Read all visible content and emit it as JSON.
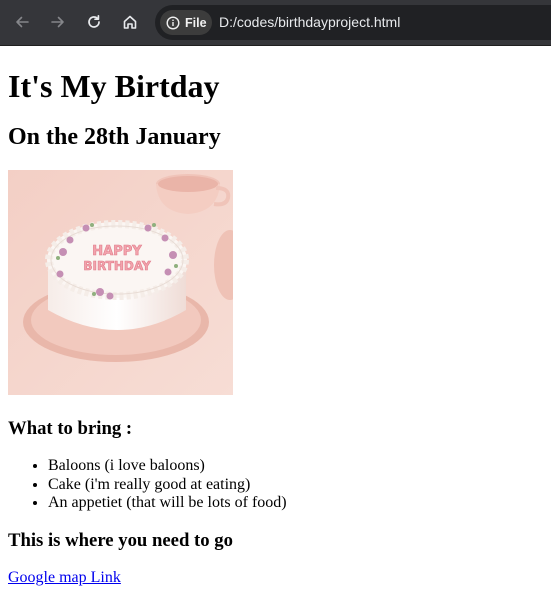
{
  "browser": {
    "chip_label": "File",
    "url": "D:/codes/birthdayproject.html"
  },
  "page": {
    "title": "It's My Birtday",
    "subtitle": "On the 28th January",
    "image_text": "HAPPY BIRTHDAY",
    "bring_heading": "What to bring :",
    "bring_items": [
      "Baloons (i love baloons)",
      "Cake (i'm really good at eating)",
      "An appetiet (that will be lots of food)"
    ],
    "go_heading": "This is where you need to go",
    "map_link": "Google map Link"
  }
}
